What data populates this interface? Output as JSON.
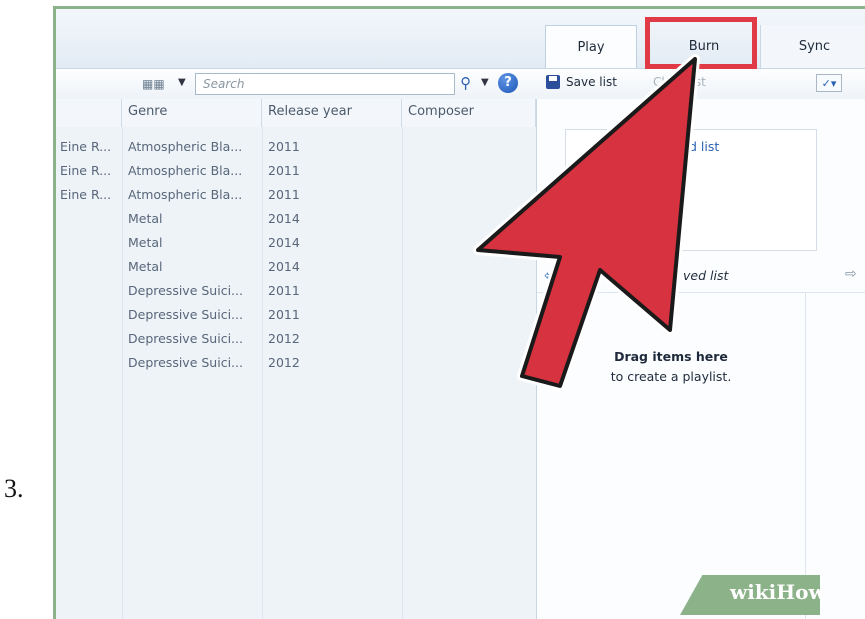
{
  "step": {
    "number": "3."
  },
  "tabs": [
    {
      "label": "Play"
    },
    {
      "label": "Burn"
    },
    {
      "label": "Sync"
    }
  ],
  "toolbar": {
    "search_placeholder": "Search",
    "save_list": "Save list",
    "clear_list": "Clear list"
  },
  "columns": {
    "genre": "Genre",
    "release_year": "Release year",
    "composer": "Composer"
  },
  "rows": [
    {
      "album": "Eine R...",
      "genre": "Atmospheric Bla...",
      "year": "2011"
    },
    {
      "album": "Eine R...",
      "genre": "Atmospheric Bla...",
      "year": "2011"
    },
    {
      "album": "Eine R...",
      "genre": "Atmospheric Bla...",
      "year": "2011"
    },
    {
      "album": "",
      "genre": "Metal",
      "year": "2014"
    },
    {
      "album": "",
      "genre": "Metal",
      "year": "2014"
    },
    {
      "album": "",
      "genre": "Metal",
      "year": "2014"
    },
    {
      "album": "",
      "genre": "Depressive Suici...",
      "year": "2011"
    },
    {
      "album": "",
      "genre": "Depressive Suici...",
      "year": "2011"
    },
    {
      "album": "",
      "genre": "Depressive Suici...",
      "year": "2012"
    },
    {
      "album": "",
      "genre": "Depressive Suici...",
      "year": "2012"
    }
  ],
  "panel": {
    "card_label": "d list",
    "unsaved_label": "ved list",
    "drag_title": "Drag items here",
    "drag_sub": "to create a playlist."
  },
  "colors": {
    "highlight": "#e03a46",
    "arrow_fill": "#d7323f",
    "watermark": "#8cb28a"
  },
  "watermark": {
    "text": "wikiHow"
  }
}
